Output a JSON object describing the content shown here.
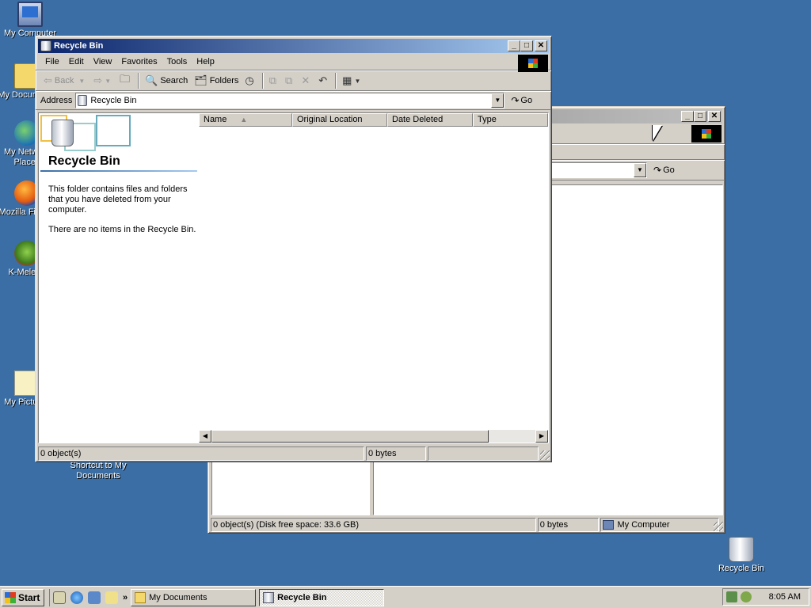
{
  "desktop": {
    "icons": [
      {
        "label": "My Computer",
        "icon": "computer-icon"
      },
      {
        "label": "My Documents",
        "icon": "folder-icon"
      },
      {
        "label": "My Network Places",
        "icon": "network-icon"
      },
      {
        "label": "Mozilla Firefox",
        "icon": "firefox-icon"
      },
      {
        "label": "K-Meleon",
        "icon": "kmeleon-icon"
      },
      {
        "label": "My Pictures",
        "icon": "pictures-icon"
      },
      {
        "label": "Shortcut to My Documents",
        "icon": "shortcut-icon"
      },
      {
        "label": "Recycle Bin",
        "icon": "recycle-bin-icon"
      }
    ],
    "background_color": "#3a6ea5"
  },
  "back_window": {
    "go_label": "Go",
    "status": {
      "objects": "0 object(s) (Disk free space: 33.6 GB)",
      "size": "0 bytes",
      "zone": "My Computer"
    }
  },
  "main_window": {
    "title": "Recycle Bin",
    "menu": [
      "File",
      "Edit",
      "View",
      "Favorites",
      "Tools",
      "Help"
    ],
    "toolbar": {
      "back": "Back",
      "search": "Search",
      "folders": "Folders"
    },
    "address": {
      "label": "Address",
      "value": "Recycle Bin",
      "go_label": "Go"
    },
    "left_pane": {
      "title": "Recycle Bin",
      "description": "This folder contains files and folders that you have deleted from your computer.",
      "empty_message": "There are no items in the Recycle Bin."
    },
    "columns": [
      "Name",
      "Original Location",
      "Date Deleted",
      "Type"
    ],
    "status": {
      "objects": "0 object(s)",
      "size": "0 bytes"
    }
  },
  "taskbar": {
    "start_label": "Start",
    "tasks": [
      {
        "label": "My Documents",
        "active": false
      },
      {
        "label": "Recycle Bin",
        "active": true
      }
    ],
    "clock": "8:05 AM"
  }
}
